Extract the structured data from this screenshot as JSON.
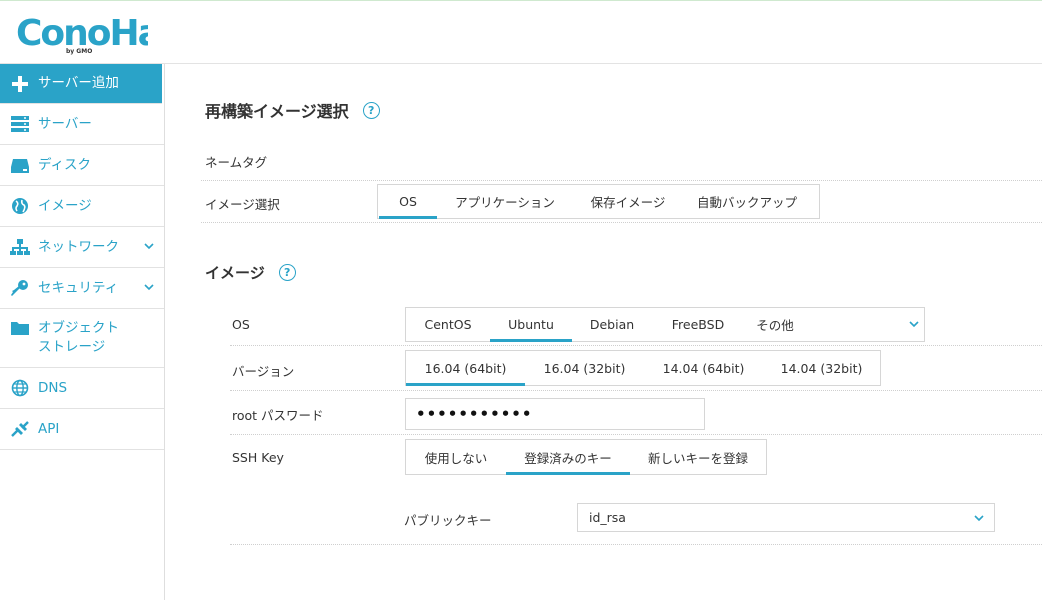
{
  "header": {
    "logo_text": "ConoHa",
    "logo_sub": "by GMO"
  },
  "sidebar": {
    "items": [
      {
        "label": "サーバー追加",
        "icon": "plus-icon"
      },
      {
        "label": "サーバー",
        "icon": "server-icon"
      },
      {
        "label": "ディスク",
        "icon": "disk-icon"
      },
      {
        "label": "イメージ",
        "icon": "globe-icon"
      },
      {
        "label": "ネットワーク",
        "icon": "network-icon"
      },
      {
        "label": "セキュリティ",
        "icon": "key-icon"
      },
      {
        "label": "オブジェクト\nストレージ",
        "icon": "folder-icon"
      },
      {
        "label": "DNS",
        "icon": "globe-icon"
      },
      {
        "label": "API",
        "icon": "api-icon"
      }
    ]
  },
  "main": {
    "title": "再構築イメージ選択",
    "help": "?",
    "name_tag_label": "ネームタグ",
    "image_select_label": "イメージ選択",
    "image_tabs": [
      "OS",
      "アプリケーション",
      "保存イメージ",
      "自動バックアップ"
    ],
    "image_section_title": "イメージ",
    "os_label": "OS",
    "os_tabs": [
      "CentOS",
      "Ubuntu",
      "Debian",
      "FreeBSD",
      "その他"
    ],
    "version_label": "バージョン",
    "version_tabs": [
      "16.04 (64bit)",
      "16.04 (32bit)",
      "14.04 (64bit)",
      "14.04 (32bit)"
    ],
    "root_password_label": "root パスワード",
    "root_password_value": "•••••••••••",
    "ssh_key_label": "SSH Key",
    "ssh_tabs": [
      "使用しない",
      "登録済みのキー",
      "新しいキーを登録"
    ],
    "public_key_label": "パブリックキー",
    "public_key_value": "id_rsa"
  },
  "colors": {
    "accent": "#2aa3c8",
    "text": "#333333",
    "border": "#d6d6d6"
  }
}
